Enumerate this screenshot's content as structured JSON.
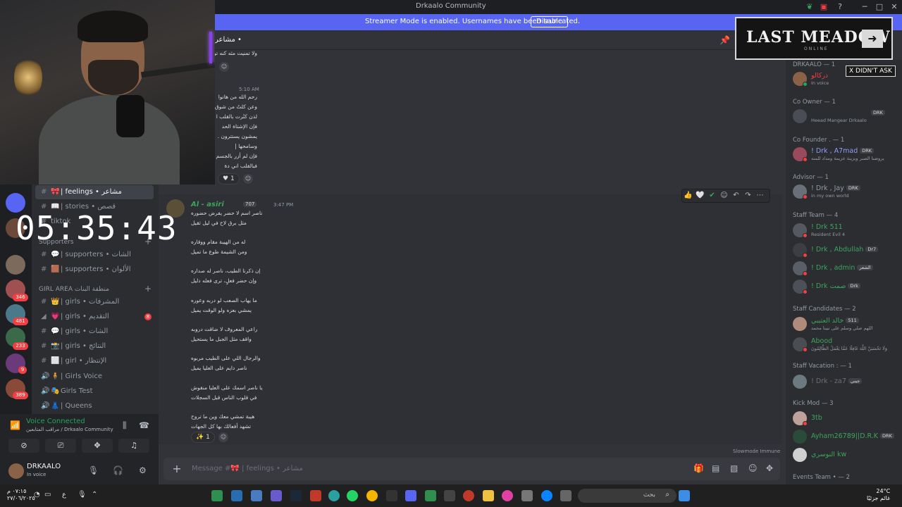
{
  "window": {
    "title": "Drkaalo Community"
  },
  "streamer": {
    "message": "Streamer Mode is enabled. Usernames have been truncated.",
    "disable_label": "Disable"
  },
  "timer": "05:35:43",
  "overlay": {
    "logo_text": "LAST MEADOW",
    "logo_sub": "ONLINE",
    "xdidnt": "X DIDN'T ASK"
  },
  "channels": {
    "items": [
      {
        "emoji": "🎀",
        "label": "| feelings • مشاعر",
        "active": true
      },
      {
        "emoji": "📖",
        "label": "| stories • قصص",
        "active": false
      },
      {
        "emoji": "",
        "label": "tiktok",
        "active": false
      }
    ],
    "category_supporters": "Supporters",
    "supporters": [
      {
        "emoji": "💬",
        "label": "| supporters • الشات"
      },
      {
        "emoji": "🟫",
        "label": "| supporters • الألوان"
      }
    ],
    "category_girl": "GIRL AREA",
    "category_girl_ar": "منطقة البنات",
    "girl": [
      {
        "emoji": "👑",
        "label": "| girls • المشرفات",
        "badge": ""
      },
      {
        "emoji": "💗",
        "label": "| girls • التقديم",
        "badge": "8"
      },
      {
        "emoji": "💬",
        "label": "| girls • الشات",
        "badge": ""
      },
      {
        "emoji": "📸",
        "label": "| girls • النتائج",
        "badge": ""
      },
      {
        "emoji": "⬜",
        "label": "| girl • الإنتظار",
        "badge": ""
      }
    ],
    "voice_channels": [
      {
        "emoji": "🧍",
        "label": "| Girls Voice"
      },
      {
        "emoji": "🎭",
        "label": "Girls Test"
      },
      {
        "emoji": "👗",
        "label": "| Queens"
      }
    ]
  },
  "rail_badges": [
    "346",
    "481",
    "233",
    "9",
    "389"
  ],
  "voice": {
    "status": "Voice Connected",
    "channel": "مراقب المتابعين / Drkaalo Community"
  },
  "user": {
    "name": "DRKAALO",
    "status": "In voice"
  },
  "chat": {
    "channel_header": "مشاعر • ",
    "msg1_time": "5:10 AM",
    "msg1_lines": [
      "رحم الله من هانوا",
      "وعن كلتُ من شوق",
      "لذن كثَرت بالقلب ا",
      "فإن الإشتاة الحد",
      "يمشون يستترون .",
      "وسامحها |",
      "فإن لم أزر بالجسم ر",
      "فبالقلب اني دة"
    ],
    "msg1_top_line": "ولا تمنيت مثه كنه تو",
    "msg1_reaction": "1",
    "msg2": {
      "author": "Al - asiri",
      "badge": "707",
      "time": "3:47 PM",
      "lines": [
        "ناصر اسم لا حضر يفرض حضوره",
        "مثل برق لاح في ليل ثقيل",
        "",
        "له من الهيبة مقام ووقاره",
        "ومن الشيمة طوع ما تميل",
        "",
        "إن ذكرنا الطيب، ناصر له صداره",
        "وإن حضر فعلٍ، ترى فعله دليل",
        "",
        "ما يهاب الصعب لو دربه وعوره",
        "يمشي بعزه ولو الوقت يميل",
        "",
        "راعي المعروف لا ضاقت دروبه",
        "واقف مثل الجبل ما يستحيل",
        "",
        "والرجال اللي على الطيب مربوه",
        "ناصر دايم على العليا يميل",
        "",
        "يا ناصر اسمك على العليا منقوش",
        "في قلوب الناس قبل السجلات",
        "",
        "هيبة تمشي معك وين ما تروح",
        "تشهد أفعالك بها كل الجهات"
      ],
      "reaction": "1"
    },
    "slowmode": "Slowmode Immune",
    "composer_placeholder": "Message #🎀 | feelings • مشاعر"
  },
  "members": [
    {
      "role": "DRKAALO — 1"
    },
    {
      "name": "دركالو",
      "sub": "In voice",
      "color": "#f23f43",
      "tag": ""
    },
    {
      "role": "Co Owner — 1"
    },
    {
      "name": "",
      "sub": "Heead Mangear Drkaalo",
      "color": "#dbdee1",
      "tag": "DRK"
    },
    {
      "role": "Co Founder . — 1"
    },
    {
      "name": "! Drk , A7mad",
      "sub": "يروضنا الصبر وبزينة عزيمة ومداد للمنه",
      "color": "#5865f2",
      "tag": "DRK"
    },
    {
      "role": "Advisor — 1"
    },
    {
      "name": "! Drk , Jay",
      "sub": "in my own world",
      "color": "#949ba4",
      "tag": "DRK"
    },
    {
      "role": "Staff Team — 4"
    },
    {
      "name": "! Drk 511",
      "sub": "Resident Evil 4",
      "color": "#3ba55c",
      "tag": ""
    },
    {
      "name": "! Drk , Abdullah",
      "sub": "",
      "color": "#3ba55c",
      "tag": "Dr7"
    },
    {
      "name": "! Drk , admin",
      "sub": "",
      "color": "#3ba55c",
      "tag": "الشعر"
    },
    {
      "name": "! Drk صمت",
      "sub": "",
      "color": "#3ba55c",
      "tag": "Drk"
    },
    {
      "role": "Staff Candidates — 2"
    },
    {
      "name": "خالد العتيبي",
      "sub": "اللهم صلي وسلم على نبينا محمد",
      "color": "#3ba55c",
      "tag": "511"
    },
    {
      "name": "Abood",
      "sub": "وَلَا تَحْسَبَنَّ اللَّهَ غَافِلًا عَمَّا يَعْمَلُ الظَّالِمُونَ",
      "color": "#3ba55c",
      "tag": ""
    },
    {
      "role": "Staff Vacation : — 1"
    },
    {
      "name": "! Drk - za7",
      "sub": "",
      "color": "#949ba4",
      "tag": "جيني"
    },
    {
      "role": "Kick Mod — 3"
    },
    {
      "name": "3tb",
      "sub": "",
      "color": "#3ba55c",
      "tag": ""
    },
    {
      "name": "Ayham26789||D.R.K",
      "sub": "",
      "color": "#3ba55c",
      "tag": "DRK"
    },
    {
      "name": "النوسري kw",
      "sub": "",
      "color": "#3ba55c",
      "tag": ""
    },
    {
      "role": "Events Team • — 2"
    }
  ],
  "taskbar": {
    "clock_time": "٠٧:١٥ م",
    "clock_date": "٢٧/٠٦/٢٠٢٥",
    "search_placeholder": "بحث",
    "weather_temp": "24°C",
    "weather_desc": "غائم جزئيًا",
    "lang": "ع"
  }
}
